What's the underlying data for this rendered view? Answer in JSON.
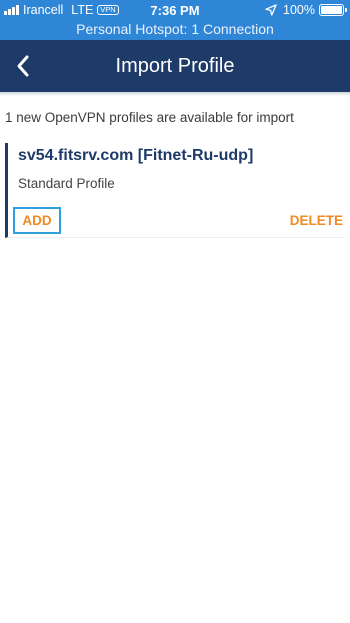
{
  "status_bar": {
    "carrier": "Irancell",
    "network": "LTE",
    "vpn_badge": "VPN",
    "time": "7:36 PM",
    "battery": "100%",
    "battery_level_percent": 100,
    "hotspot": "Personal Hotspot: 1 Connection"
  },
  "navbar": {
    "title": "Import Profile",
    "back_icon": "chevron-left-icon"
  },
  "content": {
    "info_text": "1 new OpenVPN profiles are available for import",
    "profiles": [
      {
        "name": "sv54.fitsrv.com [Fitnet-Ru-udp]",
        "type": "Standard Profile",
        "add_label": "ADD",
        "delete_label": "DELETE"
      }
    ]
  },
  "colors": {
    "status_bar": "#2f86d6",
    "navbar": "#1e3a68",
    "accent_orange": "#f08a24",
    "focus_border": "#2f9fe0"
  }
}
